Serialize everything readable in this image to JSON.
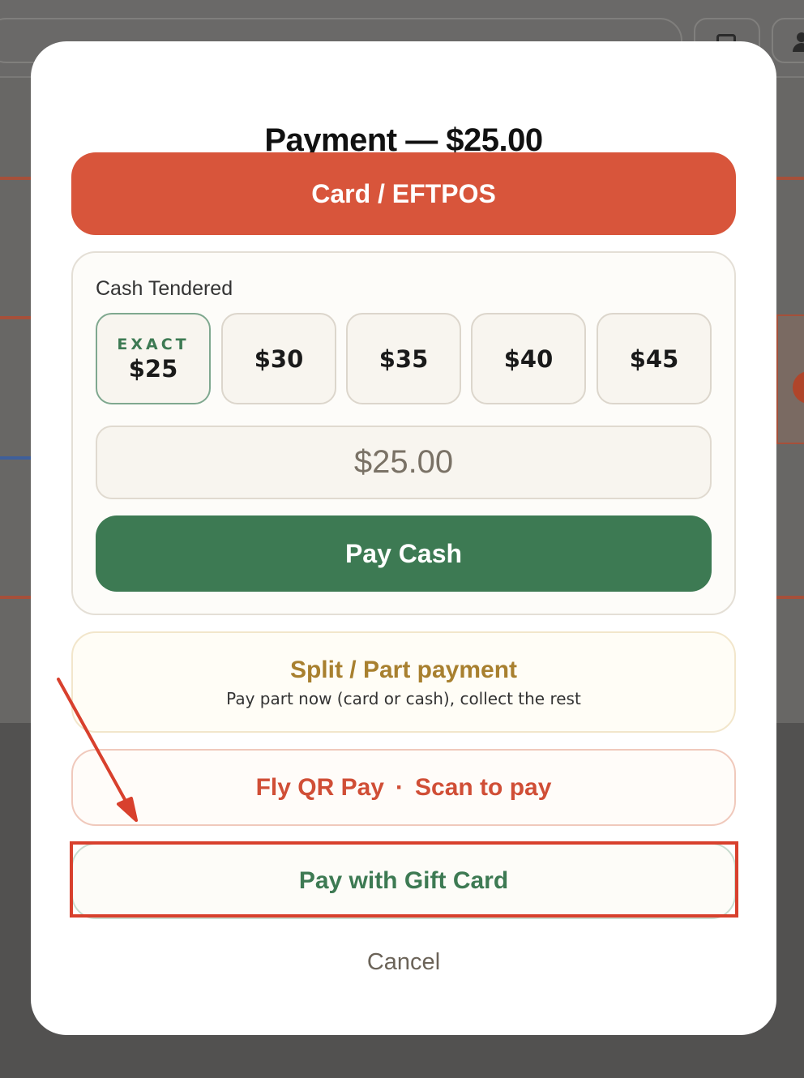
{
  "modal": {
    "title": "Payment — $25.00",
    "card_button_label": "Card / EFTPOS",
    "cash": {
      "label": "Cash Tendered",
      "quick_amounts": [
        {
          "badge": "EXACT",
          "value": "$25"
        },
        {
          "badge": "",
          "value": "$30"
        },
        {
          "badge": "",
          "value": "$35"
        },
        {
          "badge": "",
          "value": "$40"
        },
        {
          "badge": "",
          "value": "$45"
        }
      ],
      "input_placeholder": "$25.00",
      "pay_button_label": "Pay Cash"
    },
    "split": {
      "title": "Split / Part payment",
      "subtitle": "Pay part now (card or cash), collect the rest"
    },
    "qr": {
      "label": "Fly QR Pay",
      "separator": "·",
      "sub": "Scan to pay"
    },
    "gift_button_label": "Pay with Gift Card",
    "cancel_label": "Cancel"
  },
  "annotation": {
    "highlight_color": "#d8402d"
  },
  "colors": {
    "card_red": "#d8553b",
    "cash_green": "#3d7a53",
    "split_gold": "#a8802f",
    "overlay": "#525150"
  }
}
